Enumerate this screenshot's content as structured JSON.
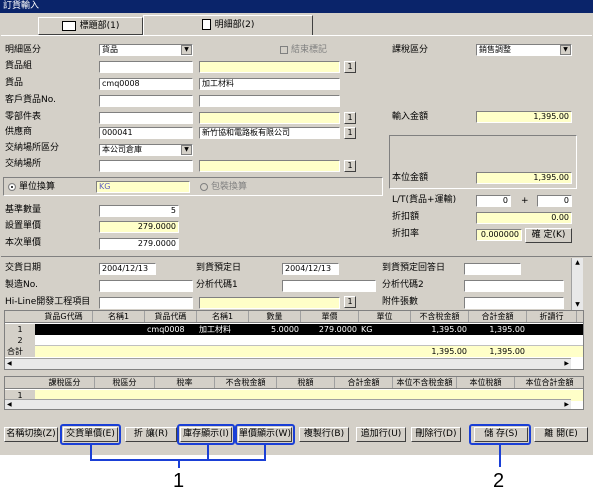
{
  "window": {
    "title": "訂貨輸入"
  },
  "tabs": [
    {
      "label": "標題部(1)"
    },
    {
      "label": "明細部(2)"
    }
  ],
  "form": {
    "detail_type_label": "明細區分",
    "detail_type_value": "貨品",
    "closed_label": "結束標記",
    "item_group_label": "貨品組",
    "item_label": "貨品",
    "item_code": "cmq0008",
    "item_name": "加工材料",
    "customer_item_label": "客戶貨品No.",
    "parts_label": "零部件表",
    "supplier_label": "供應商",
    "supplier_code": "000041",
    "supplier_name": "新竹協和電路板有限公司",
    "delivery_type_label": "交納場所區分",
    "delivery_type_value": "本公司倉庫",
    "delivery_place_label": "交納場所",
    "unit_conv_label": "單位換算",
    "unit_conv_value": "KG",
    "pack_conv_label": "包裝換算",
    "base_qty_label": "基準數量",
    "base_qty_value": "5",
    "set_price_label": "設置單價",
    "set_price_value": "279.0000",
    "this_price_label": "本次單價",
    "this_price_value": "279.0000",
    "tax_type_label": "課稅區分",
    "tax_type_value": "銷售調整",
    "input_amount_label": "輸入金額",
    "input_amount_value": "1,395.00",
    "local_amount_label": "本位金額",
    "local_amount_value": "1,395.00",
    "lt_label": "L/T(貨品+運輸)",
    "lt_value1": "0",
    "lt_plus": "+",
    "lt_value2": "0",
    "discount_amount_label": "折扣額",
    "discount_amount_value": "0.00",
    "discount_rate_label": "折扣率",
    "discount_rate_value": "0.000000",
    "confirm_button": "確 定(K)",
    "order_date_label": "交貨日期",
    "order_date_value": "2004/12/13",
    "expected_date_label": "到貨預定日",
    "expected_date_value": "2004/12/13",
    "expected_reply_label": "到貨預定回答日",
    "mfg_no_label": "製造No.",
    "analysis1_label": "分析代碼1",
    "analysis2_label": "分析代碼2",
    "hiline_label": "Hi-Line開發工程項目",
    "attach_label": "附件張數"
  },
  "grid1": {
    "headers": [
      "貨品G代碼",
      "名稱1",
      "貨品代碼",
      "名稱1",
      "數量",
      "單價",
      "單位",
      "不含稅金額",
      "合計金額",
      "折讀行"
    ],
    "row1": {
      "num": "1",
      "cols": [
        "",
        "",
        "cmq0008",
        "加工材料",
        "5.0000",
        "279.0000",
        "KG",
        "1,395.00",
        "1,395.00",
        ""
      ]
    },
    "row2_num": "2",
    "total_label": "合計",
    "total_amount": "1,395.00",
    "total_sum": "1,395.00"
  },
  "grid2": {
    "headers": [
      "課稅區分",
      "稅區分",
      "稅率",
      "不含稅金額",
      "稅額",
      "合計金額",
      "本位不含稅金額",
      "本位稅額",
      "本位合計金額"
    ],
    "row_num": "1"
  },
  "buttons": [
    {
      "label": "名稱切換(Z)"
    },
    {
      "label": "交貨單價(E)"
    },
    {
      "label": "折 讓(R)"
    },
    {
      "label": "庫存顯示(I)"
    },
    {
      "label": "單價顯示(W)"
    },
    {
      "label": "複製行(B)"
    },
    {
      "label": "追加行(U)"
    },
    {
      "label": "刪除行(D)"
    },
    {
      "label": "儲 存(S)"
    },
    {
      "label": "離 開(E)"
    }
  ],
  "callouts": {
    "one": "1",
    "two": "2"
  },
  "colors": {
    "title_bg": "#0a246a",
    "highlight": "#1a3fd6",
    "field_yellow": "#ffffc8",
    "grid_row_selected": "#000000"
  }
}
